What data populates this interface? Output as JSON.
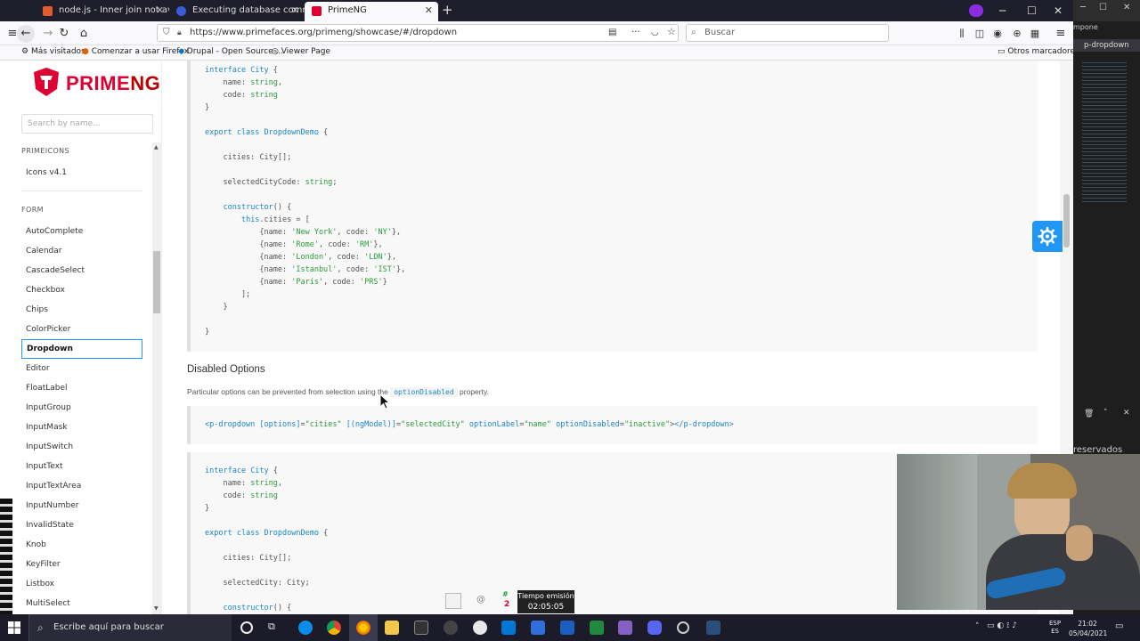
{
  "browser": {
    "tabs": [
      {
        "label": "node.js - Inner join not availab",
        "icon_color": "#e15b2d"
      },
      {
        "label": "Executing database command",
        "icon_color": "#3b5bdb"
      },
      {
        "label": "PrimeNG",
        "icon_color": "#dd0031"
      }
    ],
    "new_tab_label": "+",
    "url": "https://www.primefaces.org/primeng/showcase/#/dropdown",
    "search_placeholder": "Buscar",
    "bookmarks": [
      "Más visitados",
      "Comenzar a usar Firefox",
      "Drupal - Open Source ...",
      "Viewer Page"
    ],
    "other_bookmarks": "Otros marcadores"
  },
  "sidebar": {
    "logo_text_a": "PRIME",
    "logo_text_b": "NG",
    "search_placeholder": "Search by name...",
    "category_icons": "PRIMEICONS",
    "icons_item": "Icons v4.1",
    "category_form": "FORM",
    "items": [
      "AutoComplete",
      "Calendar",
      "CascadeSelect",
      "Checkbox",
      "Chips",
      "ColorPicker",
      "Dropdown",
      "Editor",
      "FloatLabel",
      "InputGroup",
      "InputMask",
      "InputSwitch",
      "InputText",
      "InputTextArea",
      "InputNumber",
      "InvalidState",
      "Knob",
      "KeyFilter",
      "Listbox",
      "MultiSelect"
    ],
    "active_item": "Dropdown"
  },
  "content": {
    "section_title": "Disabled Options",
    "section_desc_before": "Particular options can be prevented from selection using the",
    "section_desc_code": "optionDisabled",
    "section_desc_after": "property."
  },
  "overlay": {
    "label": "Tiempo emisión",
    "time": "02:05:05"
  },
  "taskbar": {
    "search_placeholder": "Escribe aquí para buscar",
    "lang": "ESP",
    "lang2": "ES",
    "time": "21:02",
    "date": "05/04/2021"
  },
  "right_panel": {
    "text1": "mpone",
    "text2": "p-dropdown",
    "text3": "reservados"
  },
  "colors": {
    "brand": "#dd0031",
    "accent": "#2196f3"
  }
}
